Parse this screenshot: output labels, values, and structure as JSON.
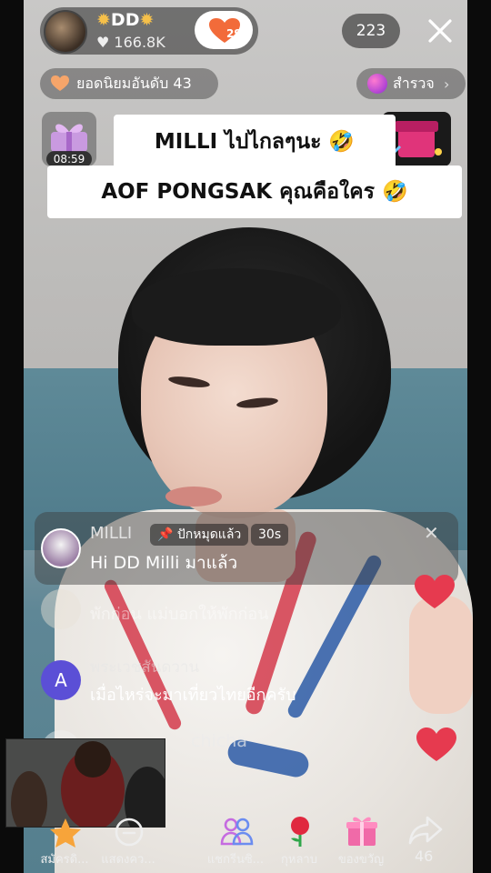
{
  "host": {
    "name": "DD",
    "name_deco_left": "✹",
    "name_deco_right": "✹",
    "likes": "♥ 166.8K"
  },
  "follow": {
    "count": "29"
  },
  "viewers": "223",
  "rank": {
    "label": "ยอดนิยมอันดับ 43"
  },
  "explore": {
    "label": "สำรวจ"
  },
  "gift": {
    "timer": "08:59"
  },
  "captions": [
    "MILLI ไปไกลๆนะ 🤣",
    "AOF PONGSAK คุณคือใคร 🤣"
  ],
  "pinned": {
    "name": "MILLI",
    "tag": "📌 ปักหมุดแล้ว",
    "time": "30s",
    "text": "Hi DD Milli มาแล้ว"
  },
  "chat": [
    {
      "name": "",
      "text": "พักก่อน แม่บอกให้พักก่อน",
      "avatar_letter": ""
    },
    {
      "name": "พระเวชสันดวาน",
      "text": "เมื่อไหร่จะมาเที่ยวไทยอีกครับ",
      "avatar_letter": "A"
    },
    {
      "name": "chicha",
      "text": "",
      "avatar_letter": ""
    }
  ],
  "bottom": {
    "items": [
      {
        "label": "สมัครดิ..."
      },
      {
        "label": "แสดงคว..."
      },
      {
        "label": "แชกรีนซิ..."
      },
      {
        "label": "กุหลาบ"
      },
      {
        "label": "ของขวัญ"
      }
    ],
    "share_count": "46"
  },
  "colors": {
    "accent_red": "#e63a4f",
    "follow_heart": "#f26b3a",
    "avatar_purple": "#5b4fd6"
  }
}
